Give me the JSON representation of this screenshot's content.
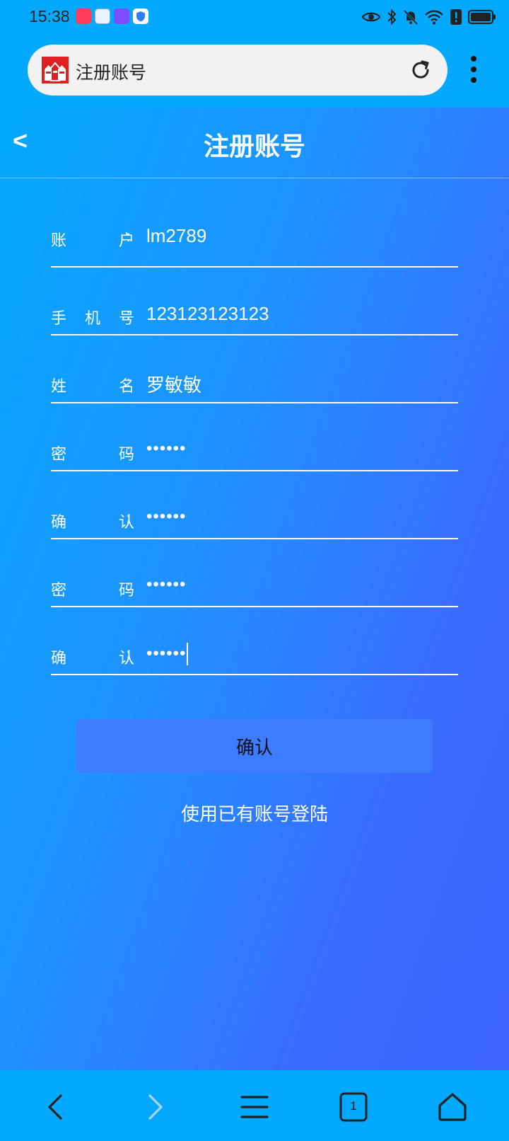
{
  "status_bar": {
    "time": "15:38",
    "notifications": [
      "app-notification-icon",
      "app-notification-icon",
      "app-notification-icon",
      "shield-notification-icon"
    ],
    "system_icons": [
      "eye-icon",
      "bluetooth-icon",
      "mute-bell-icon",
      "wifi-icon",
      "alert-icon",
      "battery-icon"
    ]
  },
  "browser": {
    "address_title": "注册账号",
    "reload_icon": "reload-icon",
    "menu_icon": "more-vertical-icon"
  },
  "header": {
    "back_label": "<",
    "title": "注册账号"
  },
  "form": {
    "fields": [
      {
        "label": [
          "账",
          "户"
        ],
        "colon": ":",
        "value": "lm2789"
      },
      {
        "label": [
          "手",
          "机",
          "号"
        ],
        "colon": ":",
        "value": "123123123123"
      },
      {
        "label": [
          "姓",
          "名"
        ],
        "colon": ":",
        "value": "罗敏敏"
      },
      {
        "label": [
          "密",
          "码"
        ],
        "colon": ":",
        "value": "••••••"
      },
      {
        "label": [
          "确",
          "认"
        ],
        "colon": ":",
        "value": "••••••"
      },
      {
        "label": [
          "密",
          "码"
        ],
        "colon": ":",
        "value": "••••••"
      },
      {
        "label": [
          "确",
          "认"
        ],
        "colon": ":",
        "value": "••••••"
      }
    ],
    "confirm_label": "确认",
    "login_link": "使用已有账号登陆"
  },
  "bottom_nav": {
    "tab_count": "1",
    "icons": [
      "back-arrow-icon",
      "forward-arrow-icon",
      "menu-icon",
      "tabs-icon",
      "home-icon"
    ]
  },
  "colors": {
    "accent": "#03a9fe",
    "gradient_end": "#3b63ff",
    "button": "#3d7bff"
  }
}
